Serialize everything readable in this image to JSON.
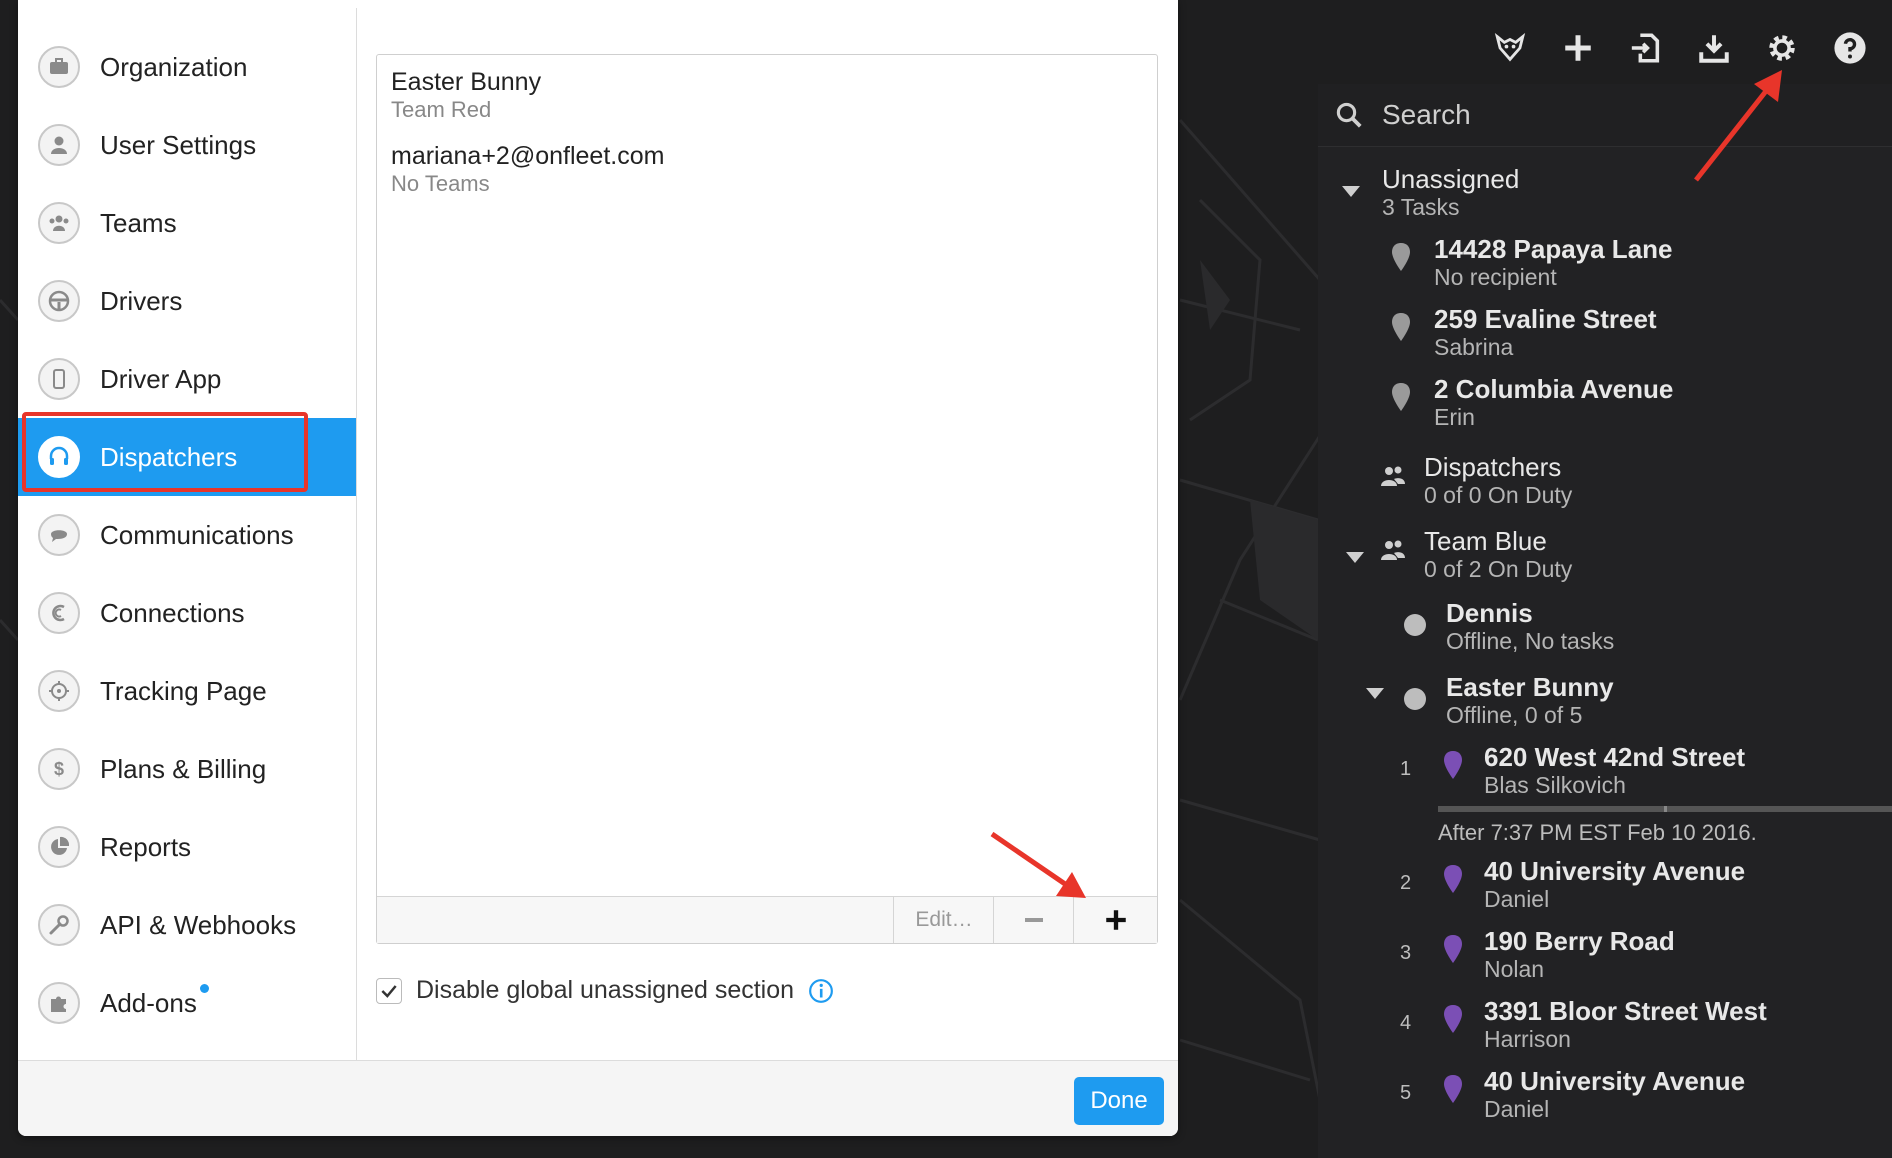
{
  "toolbar": {
    "icons": [
      "fox-logo-icon",
      "plus-icon",
      "import-icon",
      "download-icon",
      "gear-icon",
      "help-icon"
    ]
  },
  "search": {
    "placeholder": "Search"
  },
  "right_panel": {
    "unassigned": {
      "title": "Unassigned",
      "sub": "3 Tasks"
    },
    "unassigned_tasks": [
      {
        "title": "14428 Papaya Lane",
        "sub": "No recipient"
      },
      {
        "title": "259 Evaline Street",
        "sub": "Sabrina"
      },
      {
        "title": "2 Columbia Avenue",
        "sub": "Erin"
      }
    ],
    "dispatchers": {
      "title": "Dispatchers",
      "sub": "0 of 0 On Duty"
    },
    "team_blue": {
      "title": "Team Blue",
      "sub": "0 of 2 On Duty"
    },
    "drivers": [
      {
        "title": "Dennis",
        "sub": "Offline, No tasks"
      },
      {
        "title": "Easter Bunny",
        "sub": "Offline, 0 of 5"
      }
    ],
    "driver_tasks": [
      {
        "num": "1",
        "title": "620 West 42nd Street",
        "sub": "Blas Silkovich"
      },
      {
        "num": "2",
        "title": "40 University Avenue",
        "sub": "Daniel"
      },
      {
        "num": "3",
        "title": "190 Berry Road",
        "sub": "Nolan"
      },
      {
        "num": "4",
        "title": "3391 Bloor Street West",
        "sub": "Harrison"
      },
      {
        "num": "5",
        "title": "40 University Avenue",
        "sub": "Daniel"
      }
    ],
    "after_note": "After 7:37 PM EST Feb 10 2016."
  },
  "sidebar": {
    "items": [
      {
        "label": "Organization",
        "icon": "briefcase-icon"
      },
      {
        "label": "User Settings",
        "icon": "user-icon"
      },
      {
        "label": "Teams",
        "icon": "teams-icon"
      },
      {
        "label": "Drivers",
        "icon": "steering-wheel-icon"
      },
      {
        "label": "Driver App",
        "icon": "phone-icon"
      },
      {
        "label": "Dispatchers",
        "icon": "headset-icon"
      },
      {
        "label": "Communications",
        "icon": "chat-icon"
      },
      {
        "label": "Connections",
        "icon": "connections-icon"
      },
      {
        "label": "Tracking Page",
        "icon": "crosshair-icon"
      },
      {
        "label": "Plans & Billing",
        "icon": "dollar-icon"
      },
      {
        "label": "Reports",
        "icon": "pie-chart-icon"
      },
      {
        "label": "API & Webhooks",
        "icon": "wrench-icon"
      },
      {
        "label": "Add-ons",
        "icon": "puzzle-icon"
      }
    ],
    "active": "Dispatchers"
  },
  "dispatchers_list": [
    {
      "name": "Easter Bunny",
      "team": "Team Red"
    },
    {
      "name": "mariana+2@onfleet.com",
      "team": "No Teams"
    }
  ],
  "list_controls": {
    "edit_label": "Edit…"
  },
  "options": {
    "disable_global_unassigned_label": "Disable global unassigned section",
    "checked": true
  },
  "footer": {
    "done_label": "Done"
  },
  "colors": {
    "accent": "#1e9bf0",
    "highlight": "#e8352a",
    "panel_bg": "#222224",
    "task_pin": "#7b4fb5"
  }
}
